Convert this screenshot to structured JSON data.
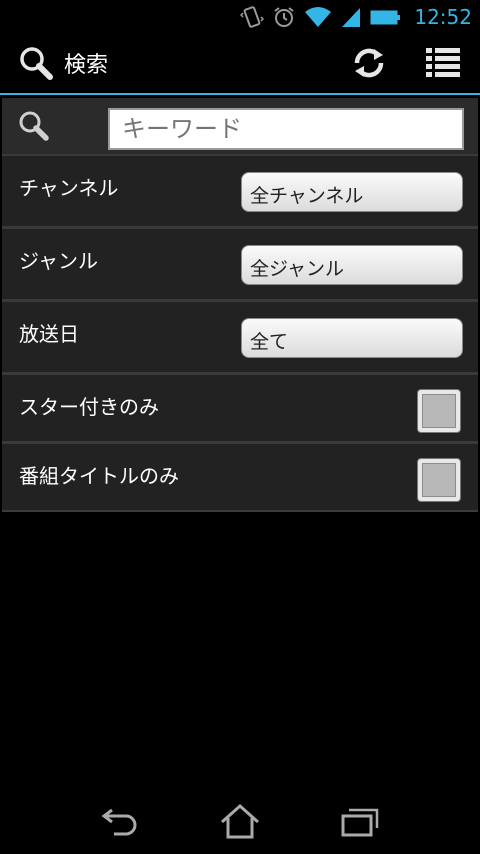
{
  "status_bar": {
    "time": "12:52",
    "icons": [
      "vibrate-icon",
      "alarm-icon",
      "wifi-icon",
      "signal-icon",
      "battery-icon"
    ]
  },
  "action_bar": {
    "title": "検索",
    "actions": [
      "refresh-icon",
      "list-icon"
    ],
    "accent_color": "#33b5e5"
  },
  "search": {
    "placeholder": "キーワード"
  },
  "filters": {
    "channel": {
      "label": "チャンネル",
      "value": "全チャンネル"
    },
    "genre": {
      "label": "ジャンル",
      "value": "全ジャンル"
    },
    "date": {
      "label": "放送日",
      "value": "全て"
    }
  },
  "options": {
    "starred": {
      "label": "スター付きのみ",
      "checked": false
    },
    "title_only": {
      "label": "番組タイトルのみ",
      "checked": false
    }
  },
  "nav_bar": {
    "buttons": [
      "back-icon",
      "home-icon",
      "recent-apps-icon"
    ]
  }
}
